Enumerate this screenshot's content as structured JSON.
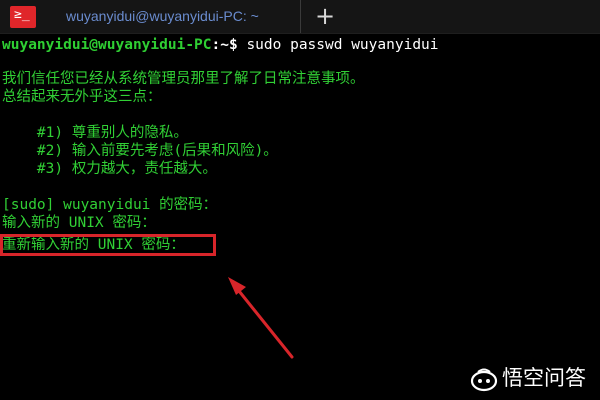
{
  "tab": {
    "app_icon_glyph": "≥_",
    "title": "wuyanyidui@wuyanyidui-PC: ~",
    "new_tab_glyph": "+"
  },
  "terminal": {
    "prompt_user_host": "wuyanyidui@wuyanyidui-PC",
    "prompt_sep": ":~$",
    "command": " sudo passwd wuyanyidui",
    "lines": [
      "我们信任您已经从系统管理员那里了解了日常注意事项。",
      "总结起来无外乎这三点：",
      "",
      "    #1) 尊重别人的隐私。",
      "    #2) 输入前要先考虑(后果和风险)。",
      "    #3) 权力越大，责任越大。",
      "",
      "[sudo] wuyanyidui 的密码：",
      "输入新的 UNIX 密码：",
      "重新输入新的 UNIX 密码："
    ]
  },
  "annotation": {
    "box_color": "#d8252a",
    "arrow_color": "#d8252a"
  },
  "watermark": {
    "text": "悟空问答",
    "icon": "wukong-logo-icon"
  },
  "colors": {
    "background": "#000000",
    "terminal_text": "#31d035",
    "tab_title": "#6a8ccf",
    "app_icon": "#e0262a"
  }
}
